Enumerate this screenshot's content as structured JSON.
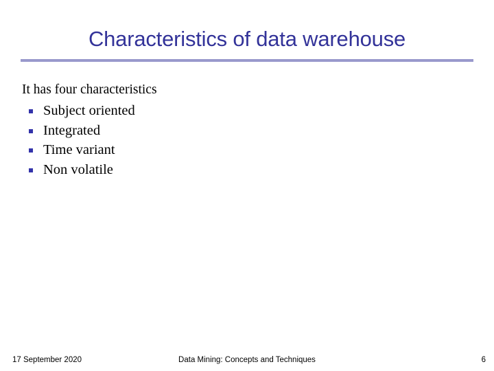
{
  "slide": {
    "title": "Characteristics of data warehouse",
    "accent_color": "#333399",
    "rule_color": "#9999cc",
    "bullet_color": "#3333aa",
    "background_color": "#ffffff"
  },
  "body": {
    "lead_line": "It has four characteristics",
    "bullets": [
      {
        "label": "Subject oriented"
      },
      {
        "label": "Integrated"
      },
      {
        "label": "Time variant"
      },
      {
        "label": "Non volatile"
      }
    ]
  },
  "footer": {
    "date": "17 September 2020",
    "center_text": "Data Mining: Concepts and Techniques",
    "page_number": "6"
  }
}
